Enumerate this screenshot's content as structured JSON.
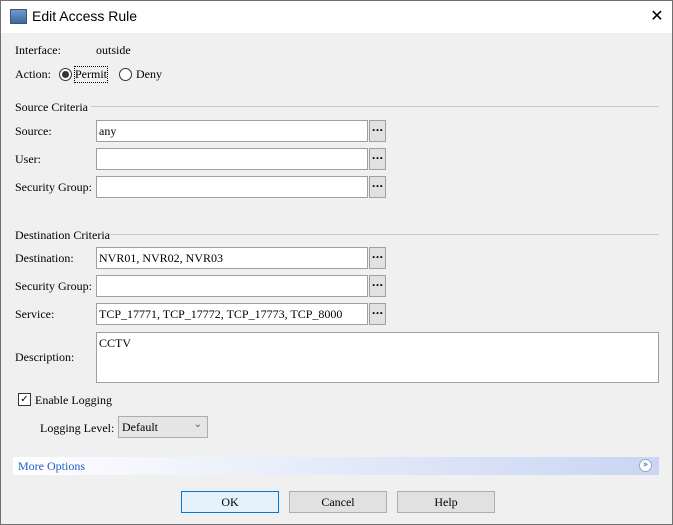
{
  "window": {
    "title": "Edit Access Rule",
    "close_icon": "close-icon"
  },
  "interface": {
    "label": "Interface:",
    "value": "outside"
  },
  "action": {
    "label": "Action:",
    "options": [
      {
        "label": "Permit",
        "selected": true
      },
      {
        "label": "Deny",
        "selected": false
      }
    ]
  },
  "source": {
    "heading": "Source Criteria",
    "source_label": "Source:",
    "source_value": "any",
    "user_label": "User:",
    "user_value": "",
    "sg_label": "Security Group:",
    "sg_value": ""
  },
  "destination": {
    "heading": "Destination Criteria",
    "dest_label": "Destination:",
    "dest_value": "NVR01, NVR02, NVR03",
    "sg_label": "Security Group:",
    "sg_value": "",
    "service_label": "Service:",
    "service_value": "TCP_17771, TCP_17772, TCP_17773, TCP_8000"
  },
  "description": {
    "label": "Description:",
    "value": "CCTV"
  },
  "browse_label": "...",
  "logging": {
    "enable_label": "Enable Logging",
    "enabled": true,
    "level_label": "Logging Level:",
    "level_value": "Default"
  },
  "more_options": {
    "label": "More Options"
  },
  "buttons": {
    "ok": "OK",
    "cancel": "Cancel",
    "help": "Help"
  }
}
